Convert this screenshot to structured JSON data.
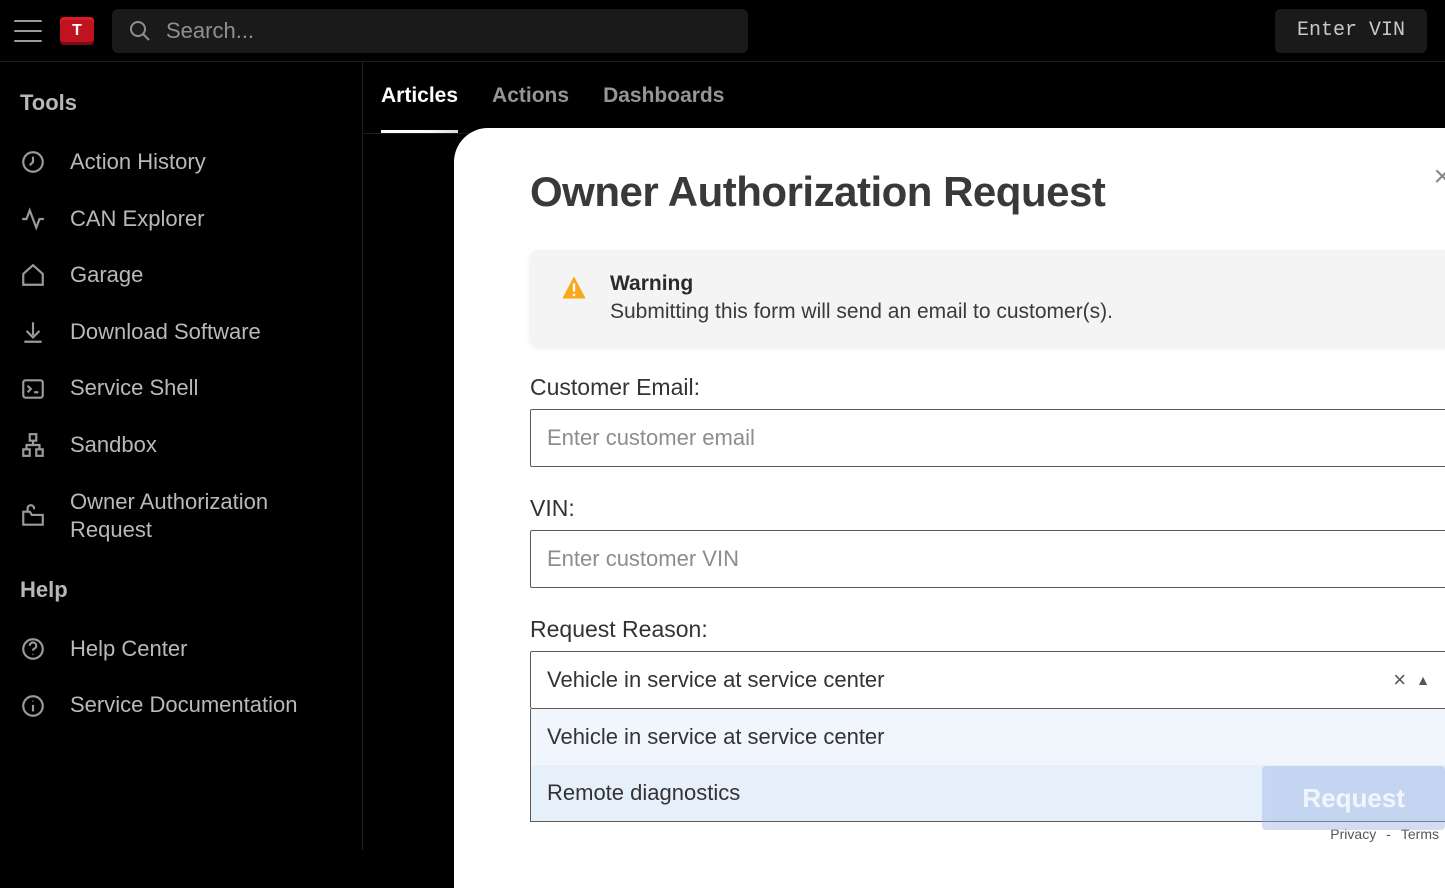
{
  "header": {
    "search_placeholder": "Search...",
    "vin_button": "Enter VIN"
  },
  "sidebar": {
    "tools_title": "Tools",
    "help_title": "Help",
    "items": [
      {
        "label": "Action History"
      },
      {
        "label": "CAN Explorer"
      },
      {
        "label": "Garage"
      },
      {
        "label": "Download Software"
      },
      {
        "label": "Service Shell"
      },
      {
        "label": "Sandbox"
      },
      {
        "label": "Owner Authorization Request"
      }
    ],
    "help_items": [
      {
        "label": "Help Center"
      },
      {
        "label": "Service Documentation"
      }
    ]
  },
  "tabs": {
    "t0": "Articles",
    "t1": "Actions",
    "t2": "Dashboards"
  },
  "modal": {
    "title": "Owner Authorization Request",
    "warning_title": "Warning",
    "warning_body": "Submitting this form will send an email to customer(s).",
    "email_label": "Customer Email:",
    "email_placeholder": "Enter customer email",
    "vin_label": "VIN:",
    "vin_placeholder": "Enter customer VIN",
    "reason_label": "Request Reason:",
    "reason_selected": "Vehicle in service at service center",
    "reason_options": [
      "Vehicle in service at service center",
      "Remote diagnostics"
    ],
    "captcha_privacy": "Privacy",
    "captcha_sep": " - ",
    "captcha_terms": "Terms",
    "submit_label": "Request"
  }
}
